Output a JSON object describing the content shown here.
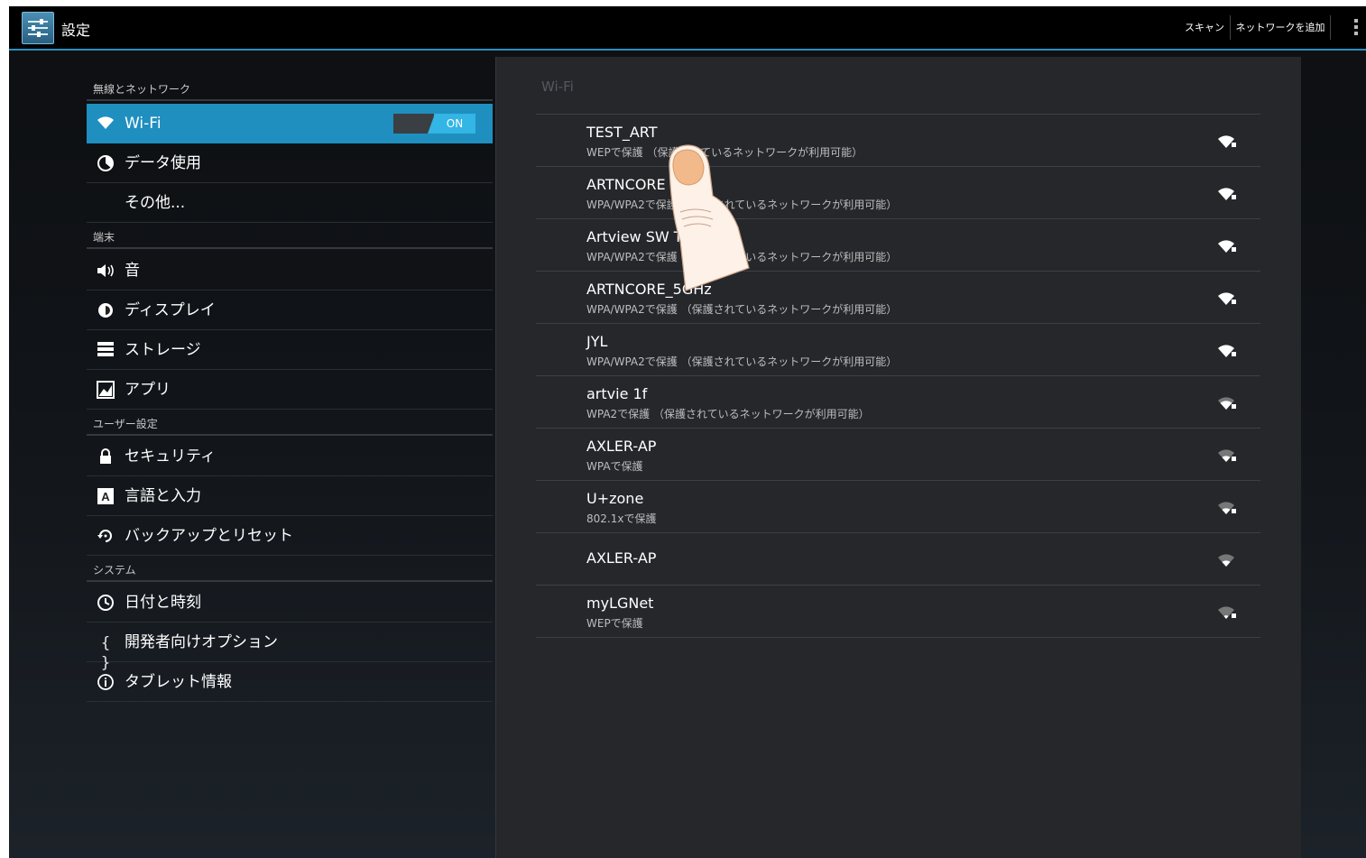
{
  "action_bar": {
    "title": "設定",
    "scan_label": "スキャン",
    "add_network_label": "ネットワークを追加"
  },
  "sidebar": {
    "categories": [
      "無線とネットワーク",
      "端末",
      "ユーザー設定",
      "システム"
    ],
    "items": [
      {
        "label": "Wi-Fi",
        "icon": "wifi-icon"
      },
      {
        "label": "データ使用",
        "icon": "data-usage-icon"
      },
      {
        "label": "その他...",
        "icon": ""
      },
      {
        "label": "音",
        "icon": "speaker-icon"
      },
      {
        "label": "ディスプレイ",
        "icon": "brightness-icon"
      },
      {
        "label": "ストレージ",
        "icon": "storage-icon"
      },
      {
        "label": "アプリ",
        "icon": "apps-icon"
      },
      {
        "label": "セキュリティ",
        "icon": "lock-icon"
      },
      {
        "label": "言語と入力",
        "icon": "keyboard-icon"
      },
      {
        "label": "バックアップとリセット",
        "icon": "backup-icon"
      },
      {
        "label": "日付と時刻",
        "icon": "clock-icon"
      },
      {
        "label": "開発者向けオプション",
        "icon": "braces-icon"
      },
      {
        "label": "タブレット情報",
        "icon": "info-icon"
      }
    ],
    "wifi_toggle_label": "ON",
    "wifi_toggle_state": "on"
  },
  "wifi_pane": {
    "title": "Wi-Fi",
    "networks": [
      {
        "ssid": "TEST_ART",
        "security": "WEPで保護 （保護されているネットワークが利用可能）",
        "signal": 4
      },
      {
        "ssid": "ARTNCORE",
        "security": "WPA/WPA2で保護 （保護されているネットワークが利用可能）",
        "signal": 4
      },
      {
        "ssid": "Artview SW T",
        "security": "WPA/WPA2で保護 （保護されているネットワークが利用可能）",
        "signal": 4
      },
      {
        "ssid": "ARTNCORE_5GHz",
        "security": "WPA/WPA2で保護 （保護されているネットワークが利用可能）",
        "signal": 4
      },
      {
        "ssid": "JYL",
        "security": "WPA/WPA2で保護 （保護されているネットワークが利用可能）",
        "signal": 4
      },
      {
        "ssid": "artvie 1f",
        "security": "WPA2で保護 （保護されているネットワークが利用可能）",
        "signal": 3
      },
      {
        "ssid": "AXLER-AP",
        "security": "WPAで保護",
        "signal": 2
      },
      {
        "ssid": "U+zone",
        "security": "802.1xで保護",
        "signal": 2
      },
      {
        "ssid": "AXLER-AP",
        "security": "",
        "signal": 2
      },
      {
        "ssid": "myLGNet",
        "security": "WEPで保護",
        "signal": 1
      }
    ]
  },
  "colors": {
    "accent": "#33b5e5",
    "selected_bg": "#1f8fbf",
    "pane_bg": "#25272b"
  }
}
